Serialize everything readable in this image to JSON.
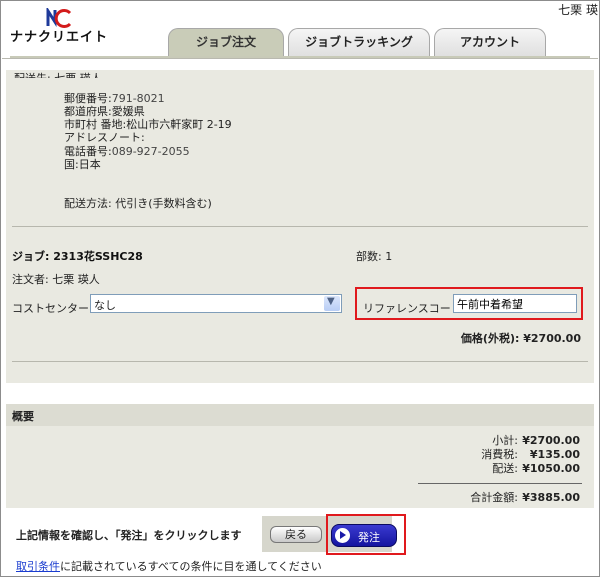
{
  "header": {
    "user_name": "七栗 瑛",
    "logo_text": "ナナクリエイト",
    "tabs": [
      {
        "label": "ジョブ注文",
        "active": true
      },
      {
        "label": "ジョブトラッキング",
        "active": false
      },
      {
        "label": "アカウント",
        "active": false
      }
    ]
  },
  "shipping": {
    "cut_label": "配送先: 七栗 瑛人",
    "postal": {
      "label": "郵便番号:",
      "value": "791-8021"
    },
    "prefecture": {
      "label": "都道府県:",
      "value": "愛媛県"
    },
    "city": {
      "label": "市町村 番地:",
      "value": "松山市六軒家町 2-19"
    },
    "address_note": {
      "label": "アドレスノート:",
      "value": ""
    },
    "phone": {
      "label": "電話番号:",
      "value": "089-927-2055"
    },
    "country": {
      "label": "国:",
      "value": "日本"
    },
    "method": {
      "label": "配送方法:",
      "value": "代引き(手数料含む)"
    }
  },
  "job": {
    "title_label": "ジョブ:",
    "title_value": "2313花SSHC28",
    "copies_label": "部数:",
    "copies_value": "1",
    "orderer_label": "注文者:",
    "orderer_value": "七栗 瑛人",
    "cost_center_label": "コストセンター:",
    "cost_center_value": "なし",
    "reference_label": "リファレンスコード:",
    "reference_value": "午前中着希望",
    "price_label": "価格(外税):",
    "price_value": "¥2700.00"
  },
  "summary": {
    "title": "概要",
    "subtotal": {
      "label": "小計:",
      "value": "¥2700.00"
    },
    "tax": {
      "label": "消費税:",
      "value": "¥135.00"
    },
    "shipping": {
      "label": "配送:",
      "value": "¥1050.00"
    },
    "total": {
      "label": "合計金額:",
      "value": "¥3885.00"
    }
  },
  "footer": {
    "confirm_text": "上記情報を確認し、「発注」をクリックします",
    "back_label": "戻る",
    "order_label": "発注",
    "terms_link": "取引条件",
    "terms_text": "に記載されているすべての条件に目を通してください"
  },
  "colors": {
    "highlight": "#e0191d",
    "panel": "#e9e9e1",
    "active_tab": "#c9ccb8",
    "order_button": "#1a1aa8"
  }
}
